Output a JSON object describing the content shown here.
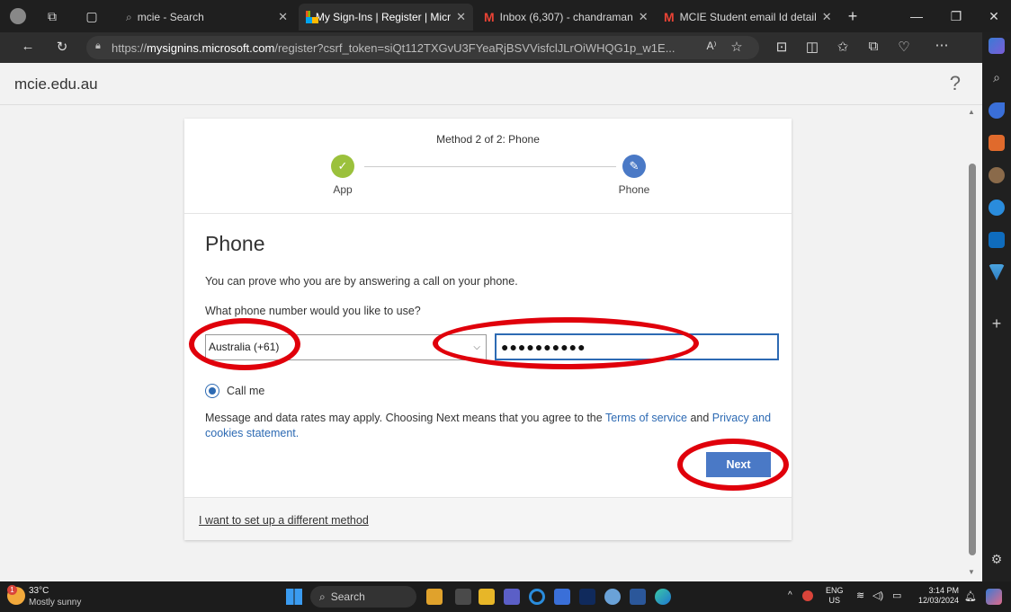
{
  "tabs": [
    {
      "label": "mcie - Search"
    },
    {
      "label": "My Sign-Ins | Register | Micr"
    },
    {
      "label": "Inbox (6,307) - chandraman"
    },
    {
      "label": "MCIE Student email Id detail"
    }
  ],
  "address": {
    "prefix": "https://",
    "host": "mysignins.microsoft.com",
    "path": "/register?csrf_token=siQt112TXGvU3FYeaRjBSVVisfclJLrOiWHQG1p_w1E..."
  },
  "page": {
    "brand": "mcie.edu.au",
    "help": "?",
    "progress_title": "Method 2 of 2: Phone",
    "steps": [
      {
        "label": "App"
      },
      {
        "label": "Phone"
      }
    ],
    "heading": "Phone",
    "intro": "You can prove who you are by answering a call on your phone.",
    "question": "What phone number would you like to use?",
    "country": "Australia (+61)",
    "phone_value": "●●●●●●●●●●",
    "radio_label": "Call me",
    "disclaimer_pre": "Message and data rates may apply. Choosing Next means that you agree to the",
    "terms": "Terms of service",
    "and": "and",
    "privacy": "Privacy and cookies statement.",
    "next": "Next",
    "different_method": "I want to set up a different method"
  },
  "taskbar": {
    "temp": "33°C",
    "weather": "Mostly sunny",
    "search": "Search",
    "lang": "ENG",
    "region": "US",
    "time": "3:14 PM",
    "date": "12/03/2024",
    "weather_badge": "1"
  },
  "colors": {
    "accent": "#4a79c6",
    "annotation": "#e0000b",
    "success": "#9bc13c"
  }
}
